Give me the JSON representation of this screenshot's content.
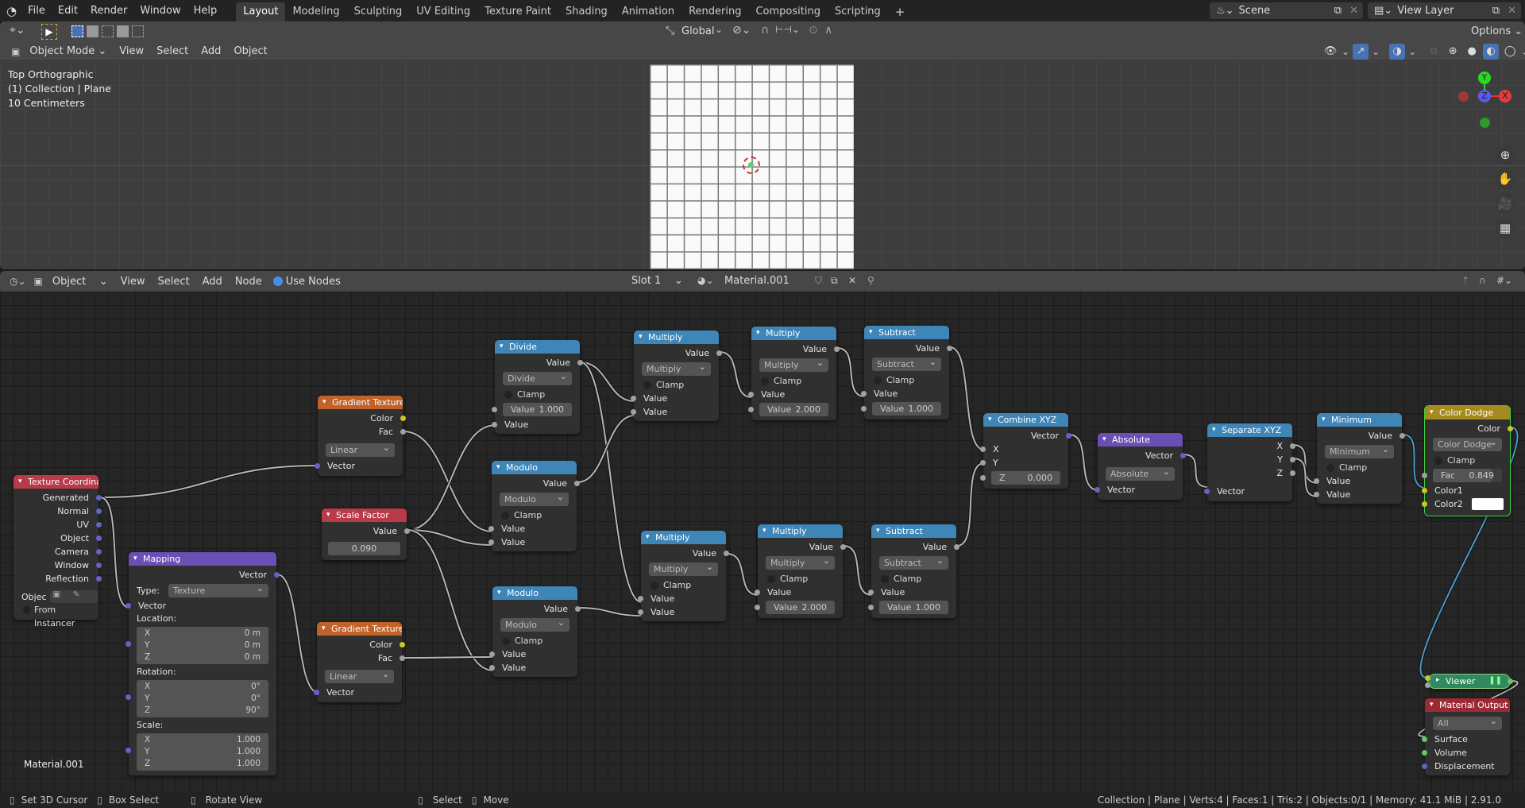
{
  "topbar": {
    "menus": [
      "File",
      "Edit",
      "Render",
      "Window",
      "Help"
    ],
    "workspaces": [
      "Layout",
      "Modeling",
      "Sculpting",
      "UV Editing",
      "Texture Paint",
      "Shading",
      "Animation",
      "Rendering",
      "Compositing",
      "Scripting"
    ],
    "active_workspace": "Layout",
    "add_workspace": "+",
    "scene": "Scene",
    "view_layer": "View Layer"
  },
  "viewport": {
    "transform_orientation": "Global",
    "options_label": "Options",
    "mode": "Object Mode",
    "menus": [
      "View",
      "Select",
      "Add",
      "Object"
    ],
    "overlay_lines": [
      "Top Orthographic",
      "(1) Collection | Plane",
      "10 Centimeters"
    ],
    "gizmo": {
      "y": "Y",
      "z": "Z",
      "x": "X"
    }
  },
  "node_editor": {
    "editor_type": "Object",
    "menus": [
      "View",
      "Select",
      "Add",
      "Node"
    ],
    "use_nodes_label": "Use Nodes",
    "slot": "Slot 1",
    "material": "Material.001",
    "material_label": "Material.001"
  },
  "nodes": {
    "tex_coord": {
      "title": "Texture Coordina...",
      "outputs": [
        "Generated",
        "Normal",
        "UV",
        "Object",
        "Camera",
        "Window",
        "Reflection"
      ],
      "object_label": "Objec",
      "from_instancer": "From Instancer"
    },
    "mapping": {
      "title": "Mapping",
      "output": "Vector",
      "type_label": "Type:",
      "type_value": "Texture",
      "input": "Vector",
      "location_label": "Location:",
      "location": [
        {
          "axis": "X",
          "value": "0 m"
        },
        {
          "axis": "Y",
          "value": "0 m"
        },
        {
          "axis": "Z",
          "value": "0 m"
        }
      ],
      "rotation_label": "Rotation:",
      "rotation": [
        {
          "axis": "X",
          "value": "0°"
        },
        {
          "axis": "Y",
          "value": "0°"
        },
        {
          "axis": "Z",
          "value": "90°"
        }
      ],
      "scale_label": "Scale:",
      "scale": [
        {
          "axis": "X",
          "value": "1.000"
        },
        {
          "axis": "Y",
          "value": "1.000"
        },
        {
          "axis": "Z",
          "value": "1.000"
        }
      ]
    },
    "grad1": {
      "title": "Gradient Texture",
      "out_color": "Color",
      "out_fac": "Fac",
      "type": "Linear",
      "input": "Vector"
    },
    "grad2": {
      "title": "Gradient Texture",
      "out_color": "Color",
      "out_fac": "Fac",
      "type": "Linear",
      "input": "Vector"
    },
    "scale_factor": {
      "title": "Scale Factor",
      "output": "Value",
      "value": "0.090"
    },
    "divide": {
      "title": "Divide",
      "output": "Value",
      "op": "Divide",
      "clamp": "Clamp",
      "field_label": "Value",
      "field_value": "1.000",
      "input": "Value"
    },
    "modulo1": {
      "title": "Modulo",
      "output": "Value",
      "op": "Modulo",
      "clamp": "Clamp",
      "inputs": [
        "Value",
        "Value"
      ]
    },
    "modulo2": {
      "title": "Modulo",
      "output": "Value",
      "op": "Modulo",
      "clamp": "Clamp",
      "inputs": [
        "Value",
        "Value"
      ]
    },
    "mult1": {
      "title": "Multiply",
      "output": "Value",
      "op": "Multiply",
      "clamp": "Clamp",
      "inputs": [
        "Value",
        "Value"
      ]
    },
    "mult2": {
      "title": "Multiply",
      "output": "Value",
      "op": "Multiply",
      "clamp": "Clamp",
      "input": "Value",
      "field_label": "Value",
      "field_value": "2.000"
    },
    "sub1": {
      "title": "Subtract",
      "output": "Value",
      "op": "Subtract",
      "clamp": "Clamp",
      "input": "Value",
      "field_label": "Value",
      "field_value": "1.000"
    },
    "mult3": {
      "title": "Multiply",
      "output": "Value",
      "op": "Multiply",
      "clamp": "Clamp",
      "inputs": [
        "Value",
        "Value"
      ]
    },
    "mult4": {
      "title": "Multiply",
      "output": "Value",
      "op": "Multiply",
      "clamp": "Clamp",
      "input": "Value",
      "field_label": "Value",
      "field_value": "2.000"
    },
    "sub2": {
      "title": "Subtract",
      "output": "Value",
      "op": "Subtract",
      "clamp": "Clamp",
      "input": "Value",
      "field_label": "Value",
      "field_value": "1.000"
    },
    "combine": {
      "title": "Combine XYZ",
      "output": "Vector",
      "inputs": [
        "X",
        "Y"
      ],
      "z_label": "Z",
      "z_value": "0.000"
    },
    "absolute": {
      "title": "Absolute",
      "output": "Vector",
      "op": "Absolute",
      "input": "Vector"
    },
    "separate": {
      "title": "Separate XYZ",
      "outputs": [
        "X",
        "Y",
        "Z"
      ],
      "input": "Vector"
    },
    "minimum": {
      "title": "Minimum",
      "output": "Value",
      "op": "Minimum",
      "clamp": "Clamp",
      "inputs": [
        "Value",
        "Value"
      ]
    },
    "color_dodge": {
      "title": "Color Dodge",
      "output": "Color",
      "op": "Color Dodge",
      "clamp": "Clamp",
      "fac_label": "Fac",
      "fac_value": "0.849",
      "fac": 0.849,
      "color1": "Color1",
      "color2": "Color2",
      "color2_value": "#ffffff"
    },
    "viewer": {
      "title": "Viewer"
    },
    "material_output": {
      "title": "Material Output",
      "target": "All",
      "inputs": [
        "Surface",
        "Volume",
        "Displacement"
      ]
    }
  },
  "statusbar": {
    "hints": [
      "Set 3D Cursor",
      "Box Select",
      "Rotate View",
      "Select",
      "Move"
    ],
    "info": "Collection | Plane | Verts:4 | Faces:1 | Tris:2 | Objects:0/1 | Memory: 41.1 MiB | 2.91.0"
  },
  "colors": {
    "accent": "#4772b3",
    "texture_header": "#c1622b",
    "math_header": "#3e85b8",
    "vector_header": "#6a4fb5",
    "input_header": "#b93a48",
    "color_header": "#a58a1f",
    "output_header": "#9c2a35",
    "viewer": "#2f8a5f"
  }
}
